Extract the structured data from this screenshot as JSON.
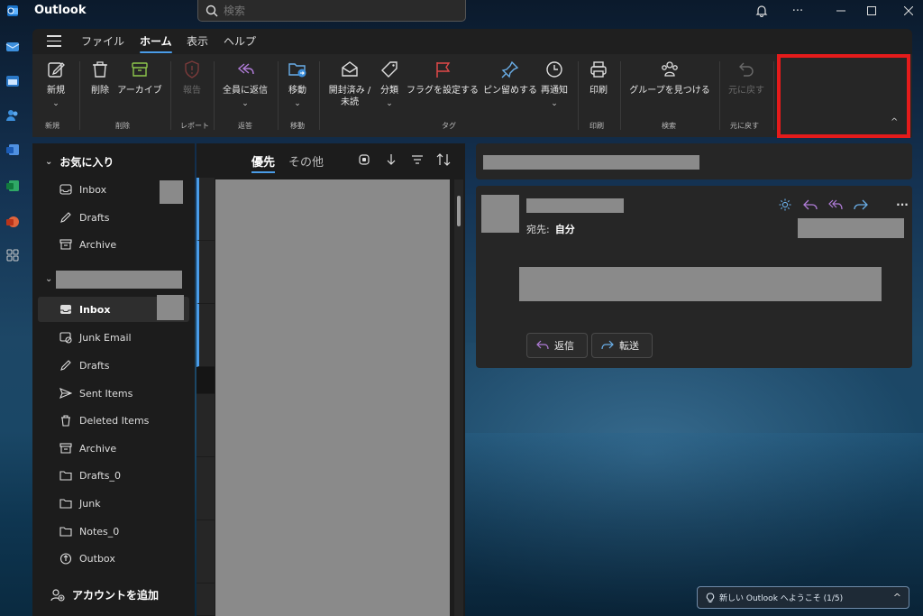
{
  "app": {
    "title": "Outlook"
  },
  "search": {
    "placeholder": "検索"
  },
  "ribbon_tabs": [
    "ファイル",
    "ホーム",
    "表示",
    "ヘルプ"
  ],
  "ribbon": {
    "new": "新規",
    "group_new": "新規",
    "delete": "削除",
    "archive": "アーカイブ",
    "group_delete": "削除",
    "report": "報告",
    "group_report": "レポート",
    "reply_all": "全員に返信",
    "group_reply": "返答",
    "move": "移動",
    "group_move": "移動",
    "mark_read_1": "開封済み /",
    "mark_read_2": "未読",
    "categorize": "分類",
    "flag": "フラグを設定する",
    "pin": "ピン留めする",
    "snooze": "再通知",
    "group_tags": "タグ",
    "print": "印刷",
    "group_print": "印刷",
    "find_groups": "グループを見つける",
    "group_find": "検索",
    "undo": "元に戻す",
    "group_undo": "元に戻す"
  },
  "folders": {
    "favorites_label": "お気に入り",
    "favorites": [
      "Inbox",
      "Drafts",
      "Archive"
    ],
    "account": [
      "Inbox",
      "Junk Email",
      "Drafts",
      "Sent Items",
      "Deleted Items",
      "Archive",
      "Drafts_0",
      "Junk",
      "Notes_0",
      "Outbox"
    ],
    "add_account": "アカウントを追加"
  },
  "message_list": {
    "tab_focused": "優先",
    "tab_other": "その他"
  },
  "reading": {
    "to_label": "宛先:",
    "to_value": "自分",
    "reply": "返信",
    "forward": "転送"
  },
  "welcome": {
    "text": "新しい Outlook へようこそ (1/5)"
  },
  "colors": {
    "accent": "#4a9ce8",
    "highlight": "#e41b1b",
    "reply_purple": "#b07cd8",
    "forward_blue": "#6aaee8"
  }
}
